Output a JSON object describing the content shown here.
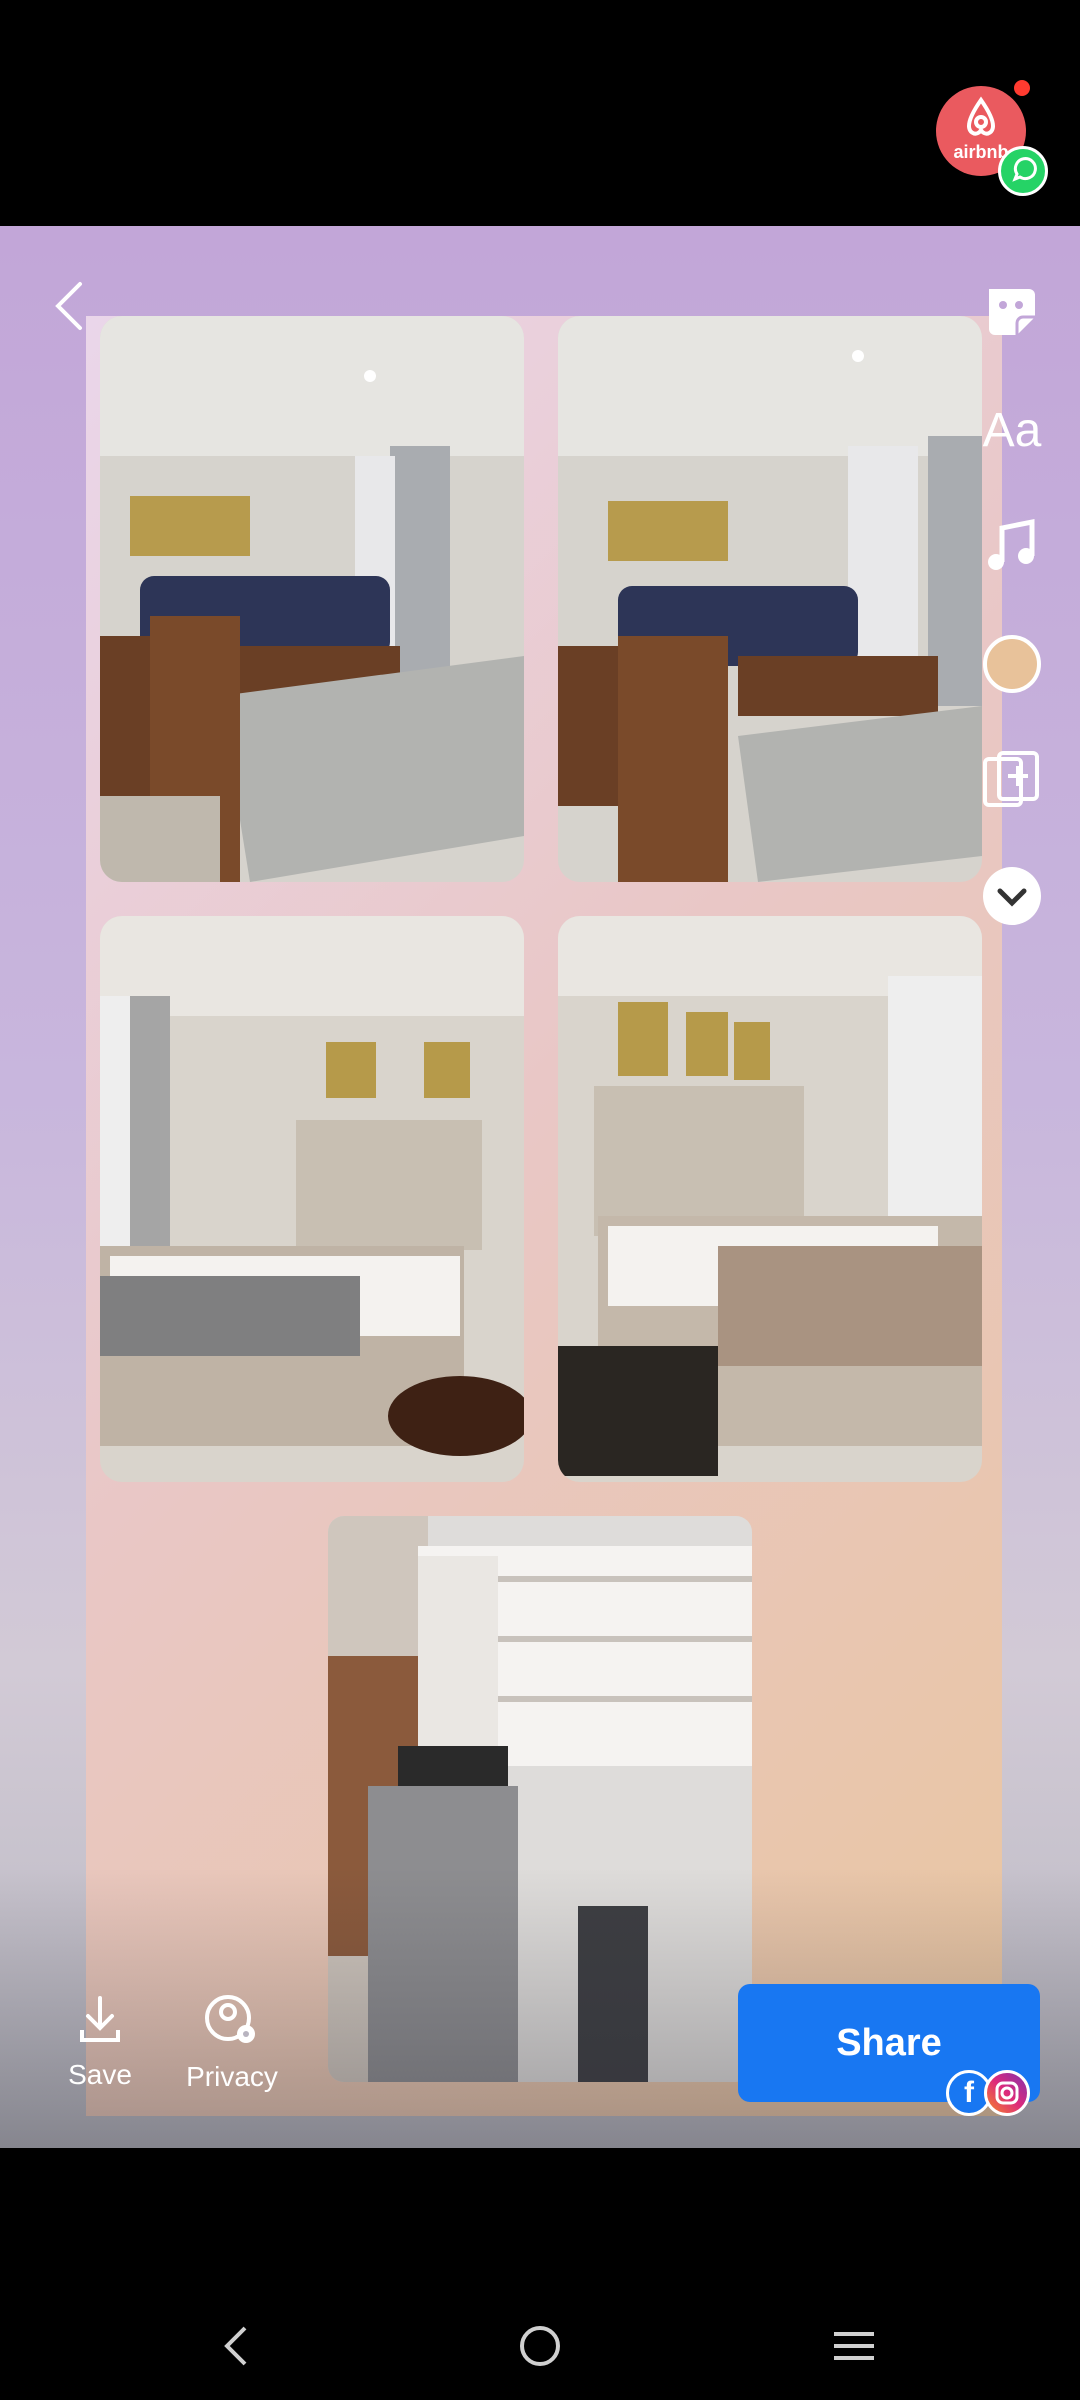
{
  "status_bar": {
    "app_badge_text": "airbnb"
  },
  "editor": {
    "back_icon": "chevron-left-icon",
    "tools": [
      {
        "name": "sticker-icon"
      },
      {
        "name": "text-tool",
        "label": "Aa"
      },
      {
        "name": "music-icon"
      },
      {
        "name": "color-circle-icon"
      },
      {
        "name": "add-layout-icon"
      },
      {
        "name": "expand-more-icon"
      }
    ],
    "photos": [
      {
        "name": "living-room-photo-1"
      },
      {
        "name": "living-room-photo-2"
      },
      {
        "name": "bedroom-photo-1"
      },
      {
        "name": "bedroom-photo-2"
      },
      {
        "name": "kitchen-photo"
      }
    ]
  },
  "actions": {
    "save_label": "Save",
    "privacy_label": "Privacy",
    "share_label": "Share"
  },
  "colors": {
    "share_button": "#1877f2",
    "airbnb_badge": "#ea5a5f",
    "whatsapp_badge": "#25d366"
  }
}
